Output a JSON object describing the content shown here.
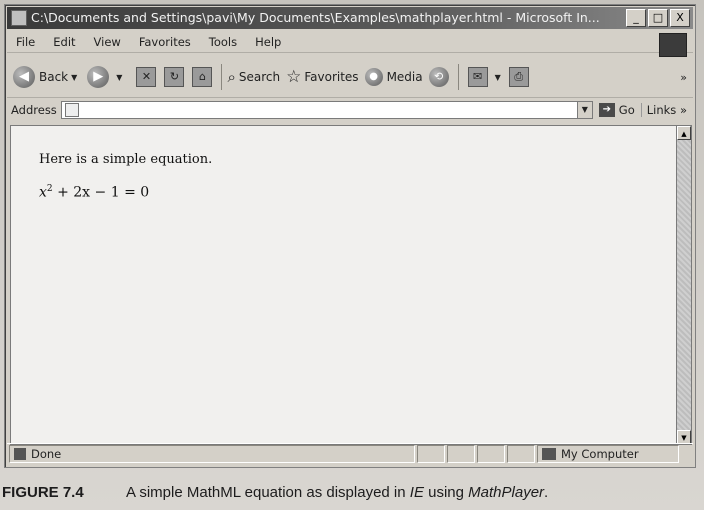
{
  "window": {
    "title": "C:\\Documents and Settings\\pavi\\My Documents\\Examples\\mathplayer.html - Microsoft In...",
    "btn_min": "_",
    "btn_max": "□",
    "btn_close": "X"
  },
  "menu": [
    "File",
    "Edit",
    "View",
    "Favorites",
    "Tools",
    "Help"
  ],
  "toolbar": {
    "back_label": "Back",
    "search_label": "Search",
    "favorites_label": "Favorites",
    "media_label": "Media",
    "overflow": "»"
  },
  "address": {
    "label": "Address",
    "value": "",
    "go_label": "Go",
    "links_label": "Links",
    "links_overflow": "»"
  },
  "content": {
    "paragraph": "Here is a simple equation.",
    "equation": {
      "base": "x",
      "exponent": "2",
      "rest": "+ 2x − 1 = 0"
    }
  },
  "status": {
    "text": "Done",
    "zone": "My Computer"
  },
  "caption": {
    "figure_number": "FIGURE 7.4",
    "text_part1": "A simple MathML equation as displayed in ",
    "ie": "IE",
    "text_part2": " using ",
    "mathplayer": "MathPlayer",
    "text_part3": "."
  }
}
